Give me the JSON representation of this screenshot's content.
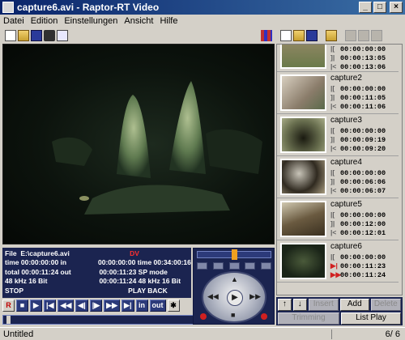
{
  "window": {
    "title": "capture6.avi - Raptor-RT Video"
  },
  "menu": [
    "Datei",
    "Edition",
    "Einstellungen",
    "Ansicht",
    "Hilfe"
  ],
  "status": {
    "file_label": "File",
    "file_value": "E:\\capture6.avi",
    "mode_tag": "DV",
    "time_label": "time",
    "time_in_value": "00:00:00:00",
    "in_label": "in",
    "in_value": "00:00:00:00",
    "time2_label": "time",
    "time2_value": "00:34:00:16",
    "total_label": "total",
    "total_value": "00:00:11:24",
    "out_label": "out",
    "out_value": "00:00:11:23",
    "sp_mode": "SP mode",
    "audio_left": "48 kHz 16 Bit",
    "audio_left_tc": "00:00:11:24",
    "audio_right": "48 kHz 16 Bit",
    "state": "STOP",
    "playback": "PLAY BACK"
  },
  "transport": {
    "rec": "R",
    "in": "in",
    "out": "out"
  },
  "clips": [
    {
      "name": "",
      "tc_in": "00:00:00:00",
      "tc_out": "00:00:13:05",
      "tc_len": "00:00:13:06"
    },
    {
      "name": "capture2",
      "tc_in": "00:00:00:00",
      "tc_out": "00:00:11:05",
      "tc_len": "00:00:11:06"
    },
    {
      "name": "capture3",
      "tc_in": "00:00:00:00",
      "tc_out": "00:00:09:19",
      "tc_len": "00:00:09:20"
    },
    {
      "name": "capture4",
      "tc_in": "00:00:00:00",
      "tc_out": "00:00:06:06",
      "tc_len": "00:00:06:07"
    },
    {
      "name": "capture5",
      "tc_in": "00:00:00:00",
      "tc_out": "00:00:12:00",
      "tc_len": "00:00:12:01"
    },
    {
      "name": "capture6",
      "tc_in": "00:00:00:00",
      "tc_out": "00:00:11:23",
      "tc_len": "00:00:11:24"
    }
  ],
  "clip_controls": {
    "insert": "Insert",
    "add": "Add",
    "delete": "Delete",
    "trimming": "Trimming",
    "list_play": "List Play"
  },
  "statusbar": {
    "project": "Untitled",
    "count": "6/ 6"
  }
}
